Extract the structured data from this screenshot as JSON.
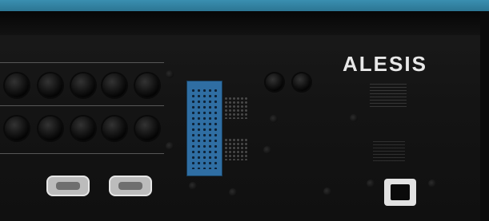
{
  "brand": {
    "logo_text": "ALESIS"
  },
  "colors": {
    "top_bar": "#3a8fb0",
    "panel": "#141414",
    "connector_blue": "#2f6ea3",
    "logo": "#e8e8e8"
  }
}
